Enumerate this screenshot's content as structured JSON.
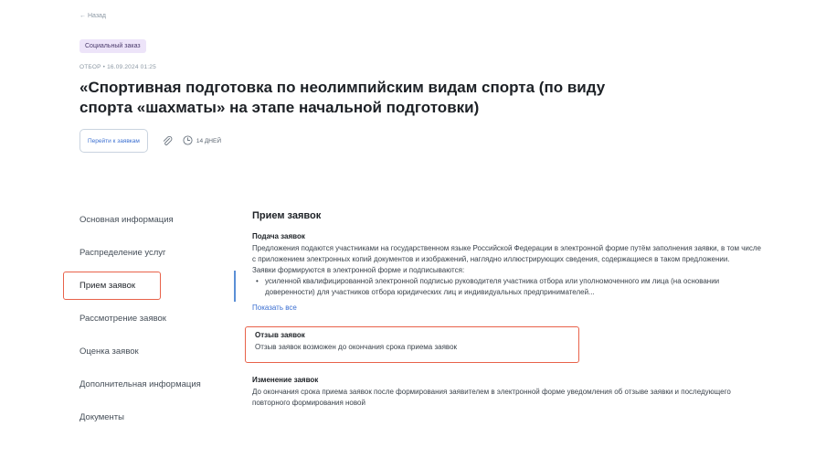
{
  "header": {
    "back_label": "← Назад",
    "badge": "Социальный заказ",
    "meta": "ОТБОР • 16.09.2024 01:25",
    "title": "«Спортивная подготовка по неолимпийским видам спорта (по виду спорта «шахматы» на этапе начальной подготовки)",
    "go_button": "Перейти к заявкам",
    "days": "14 ДНЕЙ"
  },
  "sidebar": {
    "items": [
      {
        "label": "Основная информация"
      },
      {
        "label": "Распределение услуг"
      },
      {
        "label": "Прием заявок"
      },
      {
        "label": "Рассмотрение заявок"
      },
      {
        "label": "Оценка заявок"
      },
      {
        "label": "Дополнительная информация"
      },
      {
        "label": "Документы"
      }
    ],
    "active_index": 2
  },
  "content": {
    "heading": "Прием заявок",
    "submission": {
      "title": "Подача заявок",
      "text": "Предложения подаются участниками на государственном языке Российской Федерации в электронной форме путём заполнения заявки, в том числе с приложением электронных копий документов и изображений, наглядно иллюстрирующих сведения, содержащиеся в таком предложении.",
      "text2": "Заявки формируются в электронной форме и подписываются:",
      "bullet": "усиленной квалифицированной электронной подписью руководителя участника отбора или уполномоченного им лица (на основании доверенности) для участников отбора юридических лиц и индивидуальных предпринимателей...",
      "show_all": "Показать все"
    },
    "withdrawal": {
      "title": "Отзыв заявок",
      "text": "Отзыв заявок возможен до окончания срока приема заявок"
    },
    "change": {
      "title": "Изменение заявок",
      "text": "До окончания срока приема заявок после формирования заявителем в электронной форме уведомления об отзыве заявки и последующего повторного формирования новой"
    }
  },
  "colors": {
    "accent": "#3b6fd1",
    "highlight": "#e8624a",
    "badge_bg": "#ede4f9"
  }
}
